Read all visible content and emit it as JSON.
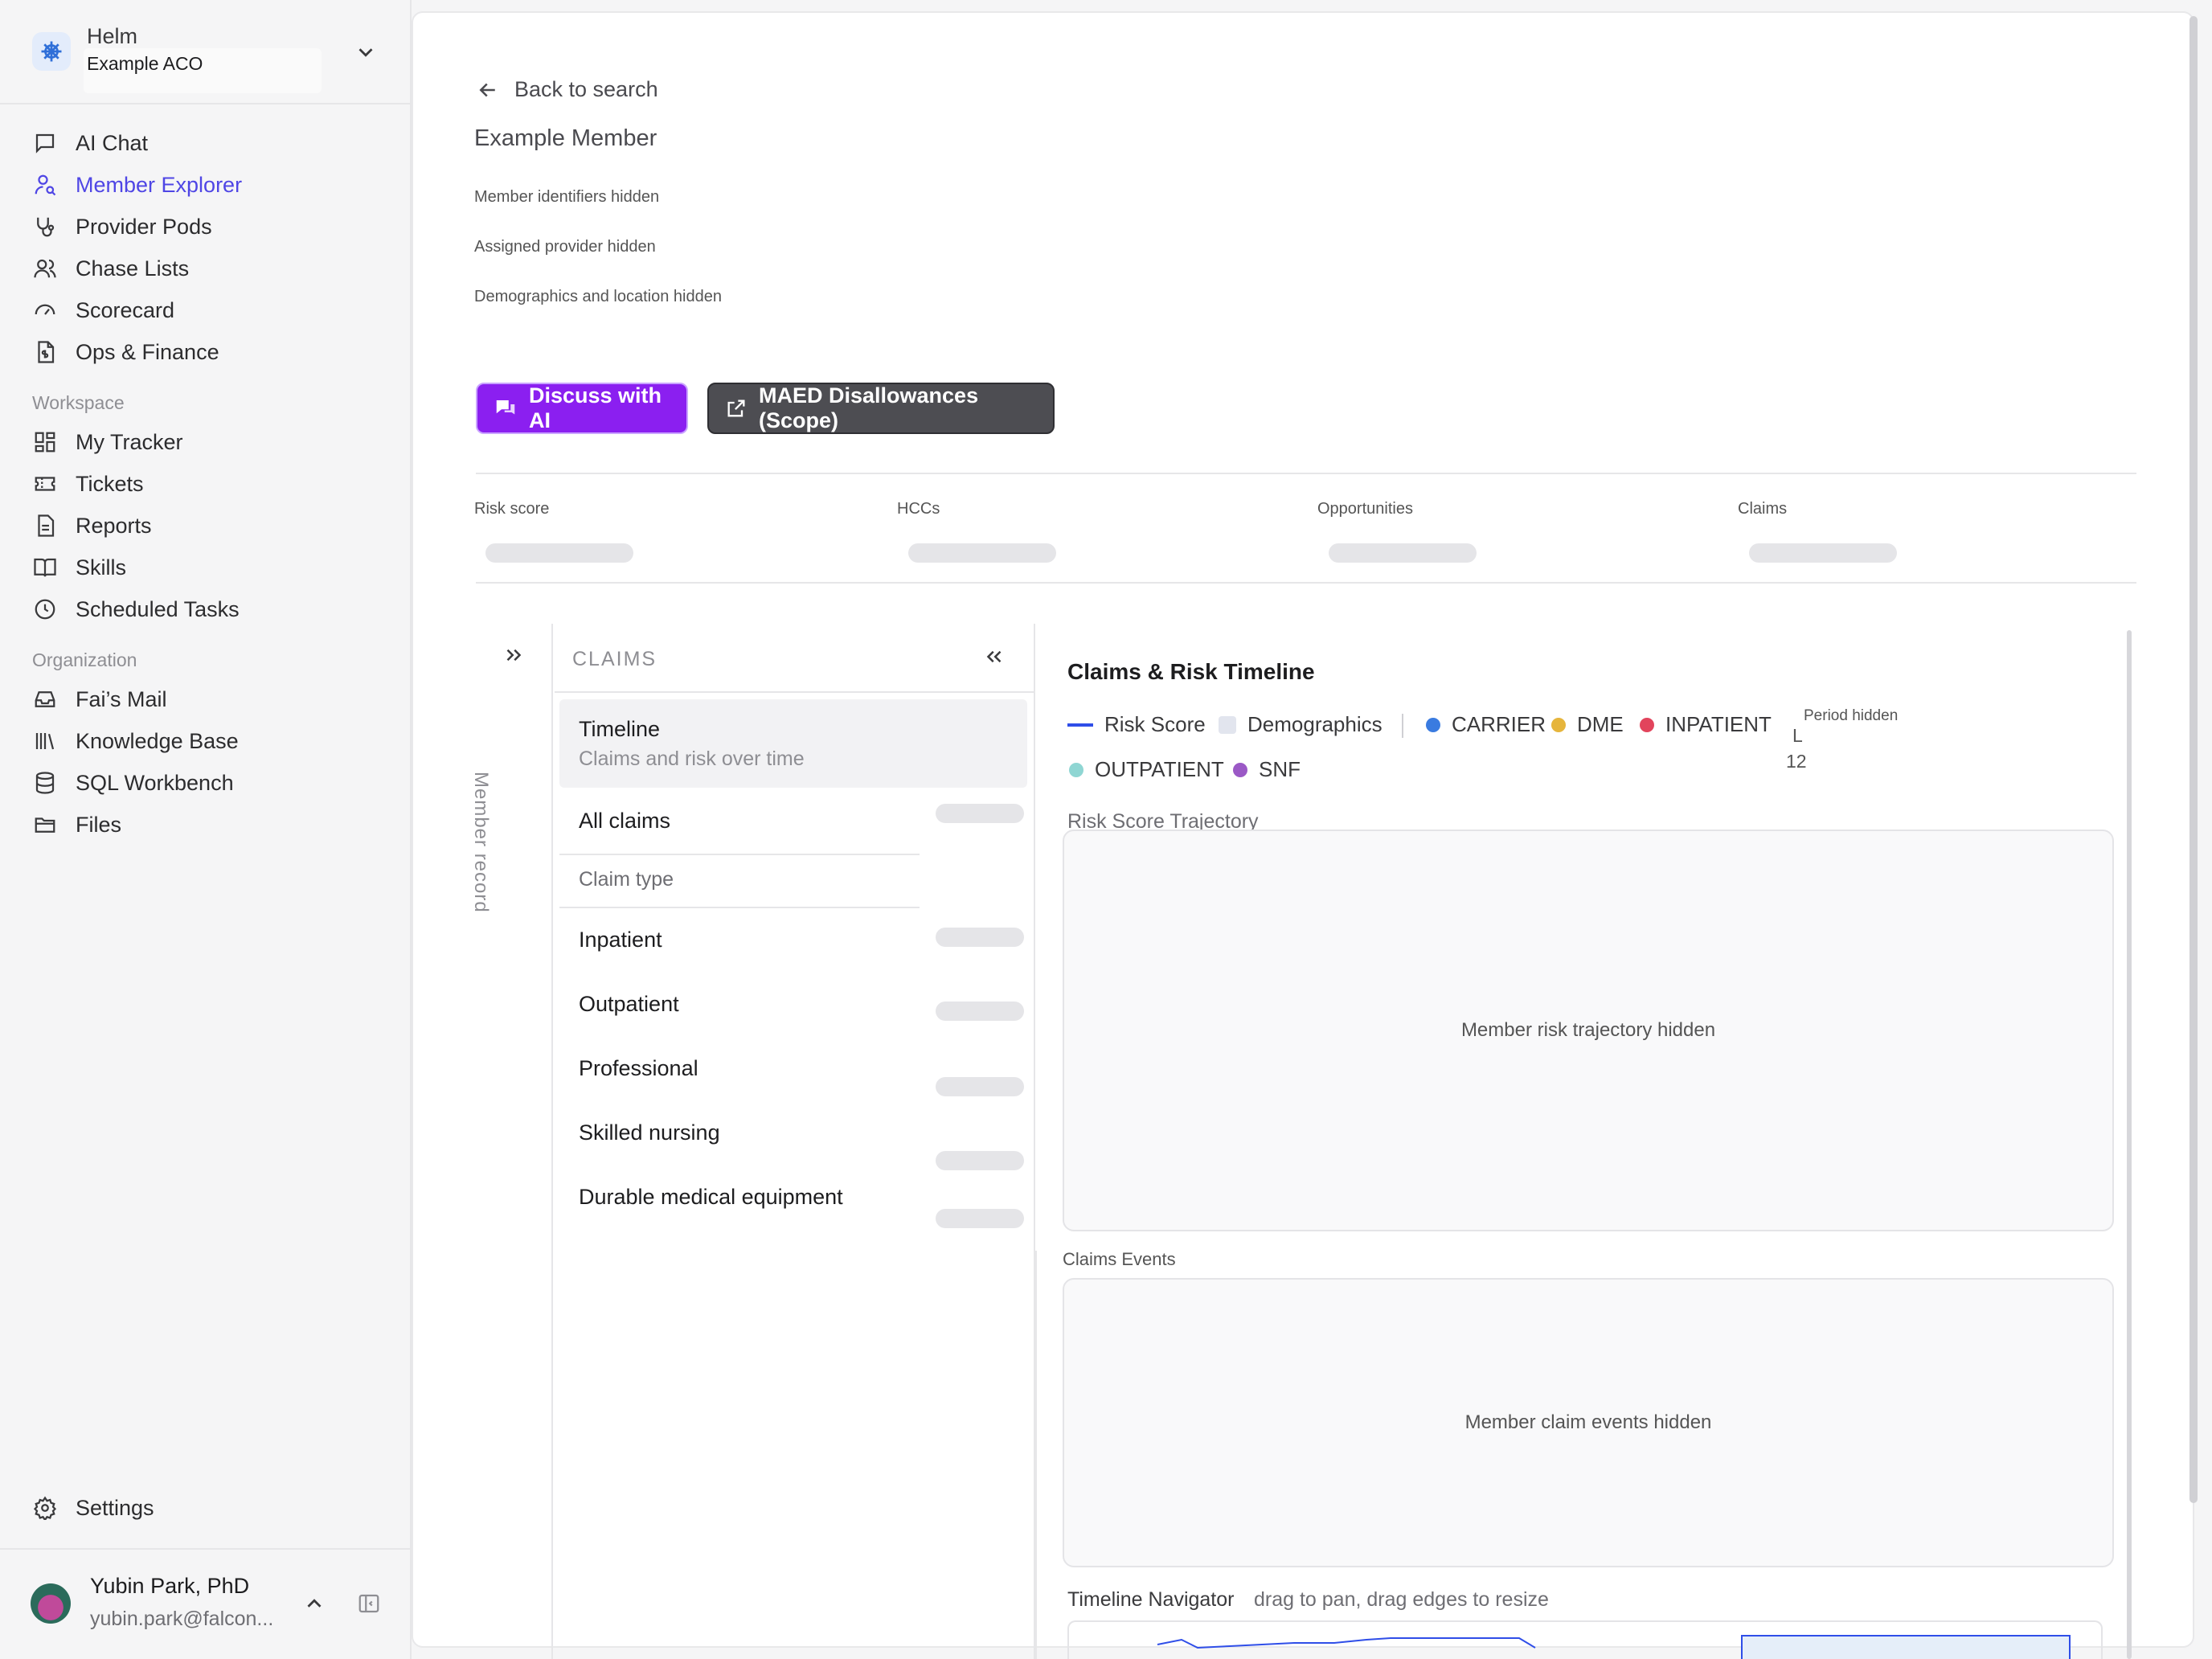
{
  "sidebar": {
    "brand": {
      "name": "Helm",
      "org": "Example ACO"
    },
    "nav": [
      {
        "label": "AI Chat",
        "icon": "chat-icon"
      },
      {
        "label": "Member Explorer",
        "icon": "user-search-icon",
        "active": true
      },
      {
        "label": "Provider Pods",
        "icon": "stethoscope-icon"
      },
      {
        "label": "Chase Lists",
        "icon": "users-icon"
      },
      {
        "label": "Scorecard",
        "icon": "gauge-icon"
      },
      {
        "label": "Ops & Finance",
        "icon": "document-dollar-icon"
      }
    ],
    "workspace_label": "Workspace",
    "workspace": [
      {
        "label": "My Tracker",
        "icon": "grid-icon"
      },
      {
        "label": "Tickets",
        "icon": "ticket-icon"
      },
      {
        "label": "Reports",
        "icon": "report-icon"
      },
      {
        "label": "Skills",
        "icon": "book-icon"
      },
      {
        "label": "Scheduled Tasks",
        "icon": "clock-icon"
      }
    ],
    "organization_label": "Organization",
    "organization": [
      {
        "label": "Fai’s Mail",
        "icon": "inbox-icon"
      },
      {
        "label": "Knowledge Base",
        "icon": "library-icon"
      },
      {
        "label": "SQL Workbench",
        "icon": "database-icon"
      },
      {
        "label": "Files",
        "icon": "folder-icon"
      }
    ],
    "settings": "Settings",
    "user": {
      "name": "Yubin Park, PhD",
      "email": "yubin.park@falcon..."
    }
  },
  "member": {
    "back": "Back to search",
    "name": "Example Member",
    "identifiers": "Member identifiers hidden",
    "provider": "Assigned provider hidden",
    "demographics": "Demographics and location hidden"
  },
  "actions": {
    "discuss": "Discuss with AI",
    "maed": "MAED Disallowances (Scope)"
  },
  "stats": {
    "risk_score": "Risk score",
    "hccs": "HCCs",
    "opportunities": "Opportunities",
    "claims": "Claims"
  },
  "claims_panel": {
    "heading": "CLAIMS",
    "rail_label": "Member record",
    "timeline": {
      "label": "Timeline",
      "sub": "Claims and risk over time"
    },
    "all_claims": "All claims",
    "claim_type": "Claim type",
    "types": [
      "Inpatient",
      "Outpatient",
      "Professional",
      "Skilled nursing",
      "Durable medical equipment"
    ]
  },
  "timeline": {
    "title": "Claims & Risk Timeline",
    "legend": {
      "risk_score": "Risk Score",
      "demographics": "Demographics",
      "carrier": "CARRIER",
      "dme": "DME",
      "inpatient": "INPATIENT",
      "outpatient": "OUTPATIENT",
      "snf": "SNF"
    },
    "period_hidden": "Period hidden",
    "period_l": "L",
    "period_12": "12",
    "trajectory_label": "Risk Score Trajectory",
    "trajectory_hidden": "Member risk trajectory hidden",
    "events_label": "Claims Events",
    "events_hidden": "Member claim events hidden",
    "navigator_label": "Timeline Navigator",
    "navigator_hint": "drag to pan, drag edges to resize"
  },
  "colors": {
    "accent": "#4f46e5",
    "ai_button": "#8b1ff0",
    "maed_button": "#4d4d52",
    "risk_line": "#2f4ee8",
    "carrier": "#3a7be0",
    "dme": "#e6b53c",
    "inpatient": "#e2445c",
    "outpatient": "#8fd6d3",
    "snf": "#9b59c6",
    "demographics": "#e2e5ee"
  }
}
